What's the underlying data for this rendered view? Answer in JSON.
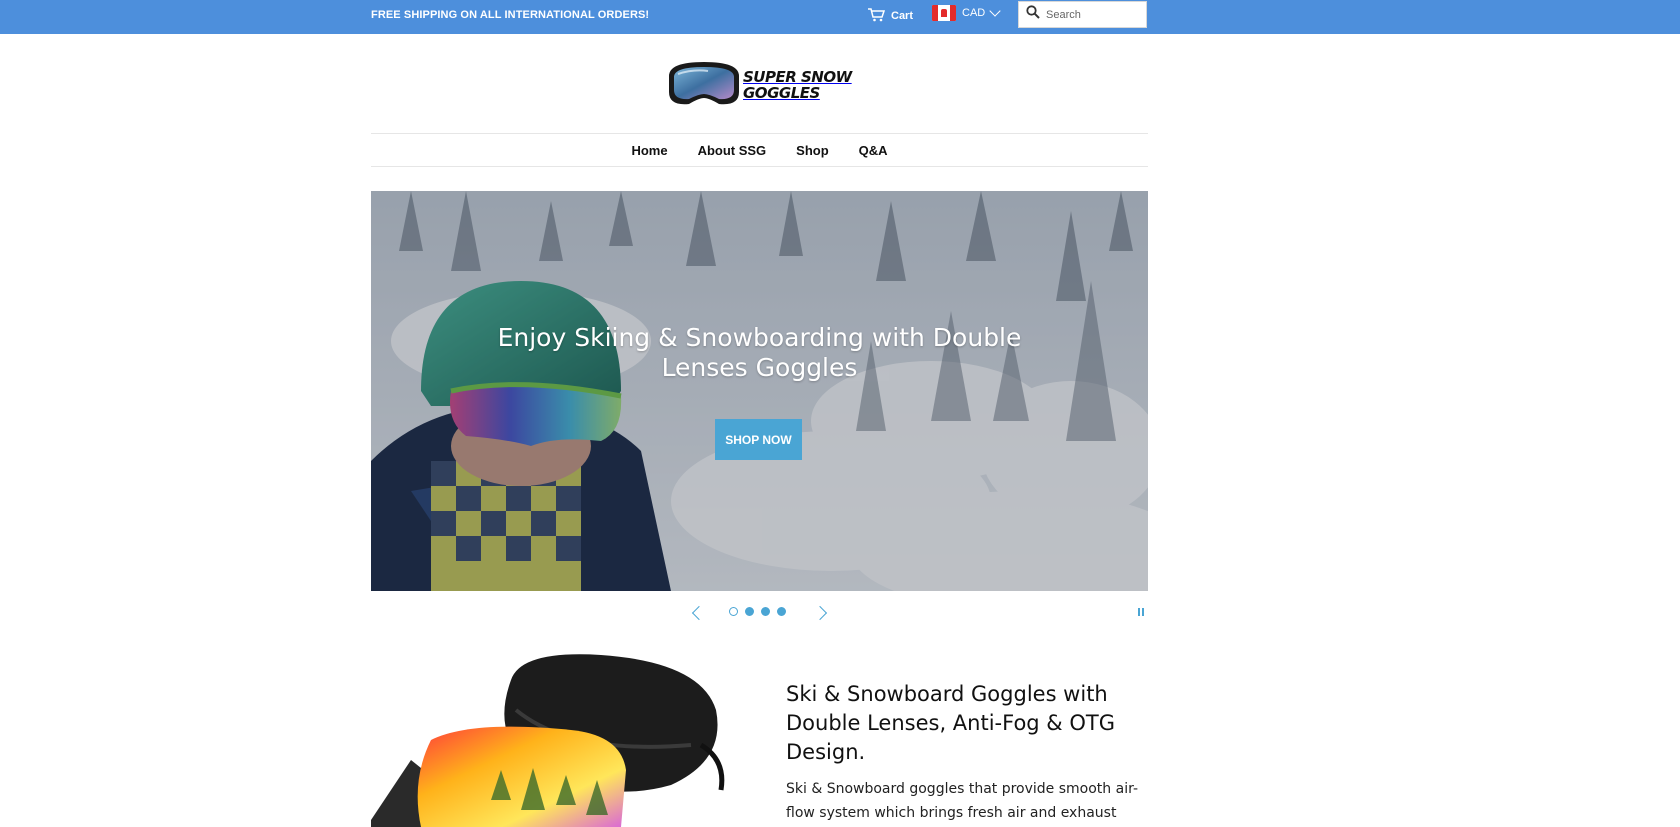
{
  "topbar": {
    "promo": "FREE SHIPPING ON ALL INTERNATIONAL ORDERS!",
    "cart_label": "Cart",
    "currency": "CAD",
    "search_placeholder": "Search",
    "background_color": "#4d8fdc"
  },
  "logo": {
    "line1": "SUPER SNOW",
    "line2": "GOGGLES"
  },
  "nav": {
    "items": [
      {
        "label": "Home"
      },
      {
        "label": "About SSG"
      },
      {
        "label": "Shop"
      },
      {
        "label": "Q&A"
      }
    ]
  },
  "hero": {
    "title": "Enjoy Skiing & Snowboarding with Double Lenses Goggles",
    "button_label": "SHOP NOW",
    "slide_count": 4,
    "active_slide": 1,
    "accent_color": "#4aa5d4"
  },
  "feature": {
    "title": "Ski & Snowboard Goggles with Double Lenses, Anti-Fog & OTG Design.",
    "body": "Ski & Snowboard  goggles that provide smooth air-flow system which brings fresh air and exhaust"
  }
}
